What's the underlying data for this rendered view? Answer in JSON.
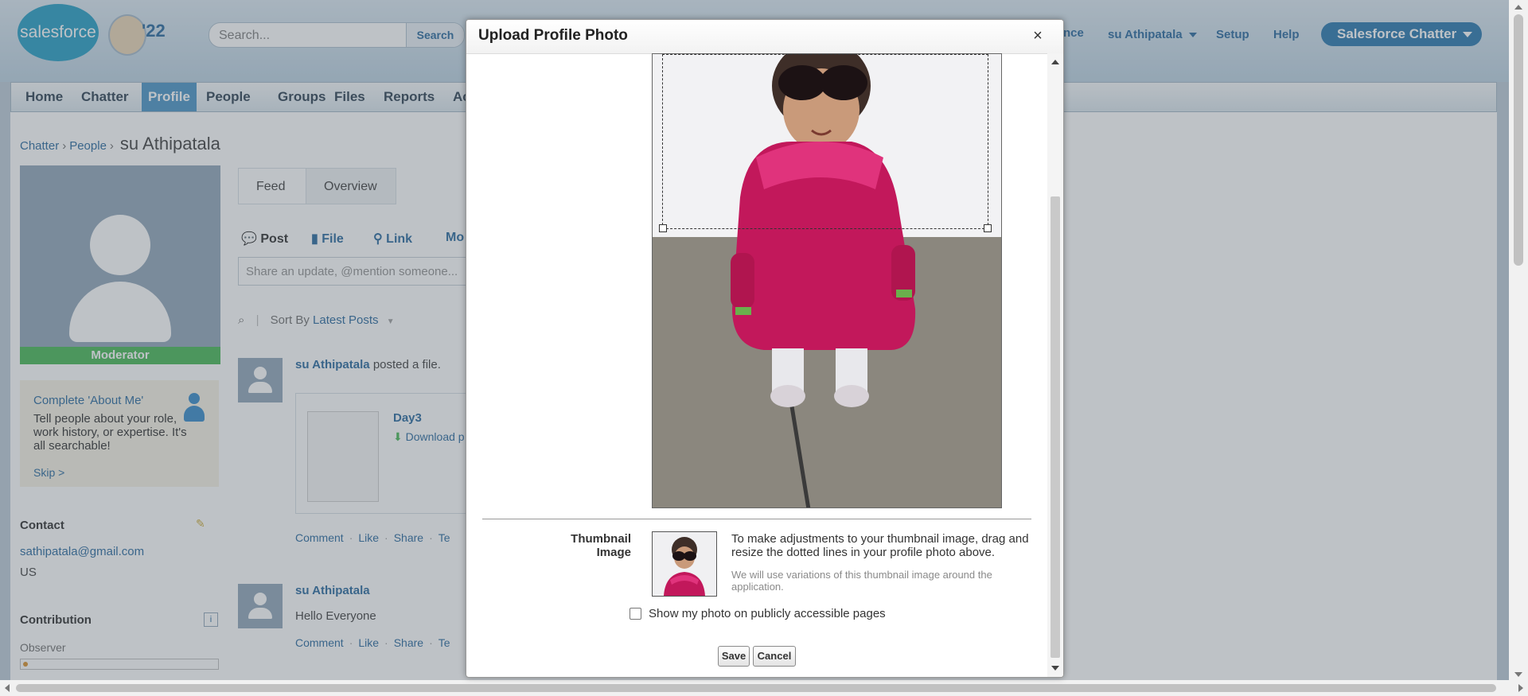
{
  "header": {
    "search_placeholder": "Search...",
    "search_button": "Search",
    "partial_link": "nce",
    "user_menu": "su Athipatala",
    "setup": "Setup",
    "help": "Help",
    "app_menu": "Salesforce Chatter",
    "logo_text": "salesforce",
    "release_badge": "'22"
  },
  "tabs": [
    {
      "label": "Home"
    },
    {
      "label": "Chatter"
    },
    {
      "label": "Profile"
    },
    {
      "label": "People"
    },
    {
      "label": "Groups"
    },
    {
      "label": "Files"
    },
    {
      "label": "Reports"
    },
    {
      "label": "Ac"
    }
  ],
  "breadcrumb": {
    "chatter": "Chatter",
    "people": "People",
    "name": "su Athipatala",
    "sep": "›"
  },
  "profile": {
    "role_badge": "Moderator",
    "about_title": "Complete 'About Me'",
    "about_text": "Tell people about your role, work history, or expertise. It's all searchable!",
    "skip": "Skip >",
    "contact_heading": "Contact",
    "email": "sathipatala@gmail.com",
    "country": "US",
    "contribution_heading": "Contribution",
    "contribution_level": "Observer"
  },
  "feed": {
    "tab_feed": "Feed",
    "tab_overview": "Overview",
    "action_post": "Post",
    "action_file": "File",
    "action_link": "Link",
    "action_more": "Mo",
    "share_placeholder": "Share an update, @mention someone...",
    "sort_by": "Sort By",
    "sort_value": "Latest Posts",
    "posts": [
      {
        "author": "su Athipatala",
        "text": "posted a file.",
        "file_name": "Day3",
        "download": "Download p",
        "actions": [
          "Comment",
          "Like",
          "Share",
          "Te"
        ]
      },
      {
        "author": "su Athipatala",
        "text": "Hello Everyone",
        "actions": [
          "Comment",
          "Like",
          "Share",
          "Te"
        ]
      }
    ]
  },
  "modal": {
    "title": "Upload Profile Photo",
    "close": "×",
    "thumbnail_label": "Thumbnail Image",
    "thumbnail_help": "To make adjustments to your thumbnail image, drag and resize the dotted lines in your profile photo above.",
    "thumbnail_note": "We will use variations of this thumbnail image around the application.",
    "public_checkbox_label": "Show my photo on publicly accessible pages",
    "public_checkbox_checked": false,
    "save": "Save",
    "cancel": "Cancel"
  },
  "colors": {
    "brand_blue": "#1798c1",
    "active_tab": "#3f8dc3",
    "moderator_green": "#3bb34a",
    "link_blue": "#1b5f98"
  }
}
